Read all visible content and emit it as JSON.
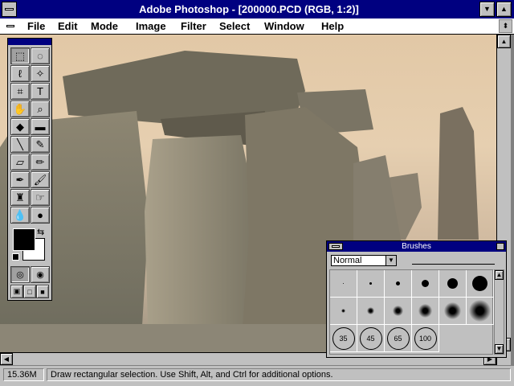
{
  "window": {
    "title": "Adobe Photoshop - [200000.PCD  (RGB, 1:2)]",
    "minimize_glyph": "▼",
    "maximize_glyph": "▲",
    "restore_glyph": "⬍"
  },
  "menu": {
    "items": [
      "File",
      "Edit",
      "Mode",
      "Image",
      "Filter",
      "Select",
      "Window",
      "Help"
    ]
  },
  "toolbox": {
    "tools": [
      {
        "name": "rect-marquee-icon",
        "glyph": "⬚"
      },
      {
        "name": "ellipse-marquee-icon",
        "glyph": "◌"
      },
      {
        "name": "lasso-icon",
        "glyph": "ℓ"
      },
      {
        "name": "magic-wand-icon",
        "glyph": "✧"
      },
      {
        "name": "crop-icon",
        "glyph": "⌗"
      },
      {
        "name": "type-icon",
        "glyph": "T"
      },
      {
        "name": "hand-icon",
        "glyph": "✋"
      },
      {
        "name": "zoom-icon",
        "glyph": "⌕"
      },
      {
        "name": "paint-bucket-icon",
        "glyph": "◆"
      },
      {
        "name": "gradient-icon",
        "glyph": "▬"
      },
      {
        "name": "line-icon",
        "glyph": "╲"
      },
      {
        "name": "eyedropper-icon",
        "glyph": "✎"
      },
      {
        "name": "eraser-icon",
        "glyph": "▱"
      },
      {
        "name": "pencil-icon",
        "glyph": "✏"
      },
      {
        "name": "airbrush-icon",
        "glyph": "✒"
      },
      {
        "name": "paintbrush-icon",
        "glyph": "🖌"
      },
      {
        "name": "rubber-stamp-icon",
        "glyph": "♜"
      },
      {
        "name": "smudge-icon",
        "glyph": "☞"
      },
      {
        "name": "blur-icon",
        "glyph": "💧"
      },
      {
        "name": "sharpen-icon",
        "glyph": "●"
      }
    ],
    "colors": {
      "foreground": "#000000",
      "background": "#ffffff"
    }
  },
  "brushes": {
    "title": "Brushes",
    "mode": "Normal",
    "large_brush_labels": [
      "35",
      "45",
      "65",
      "100"
    ],
    "hard_sizes": [
      1,
      3,
      5,
      9,
      13,
      19
    ],
    "soft_sizes": [
      5,
      9,
      13,
      17,
      21,
      27
    ]
  },
  "status": {
    "size": "15.36M",
    "message": "Draw rectangular selection. Use Shift, Alt, and Ctrl for additional options."
  }
}
